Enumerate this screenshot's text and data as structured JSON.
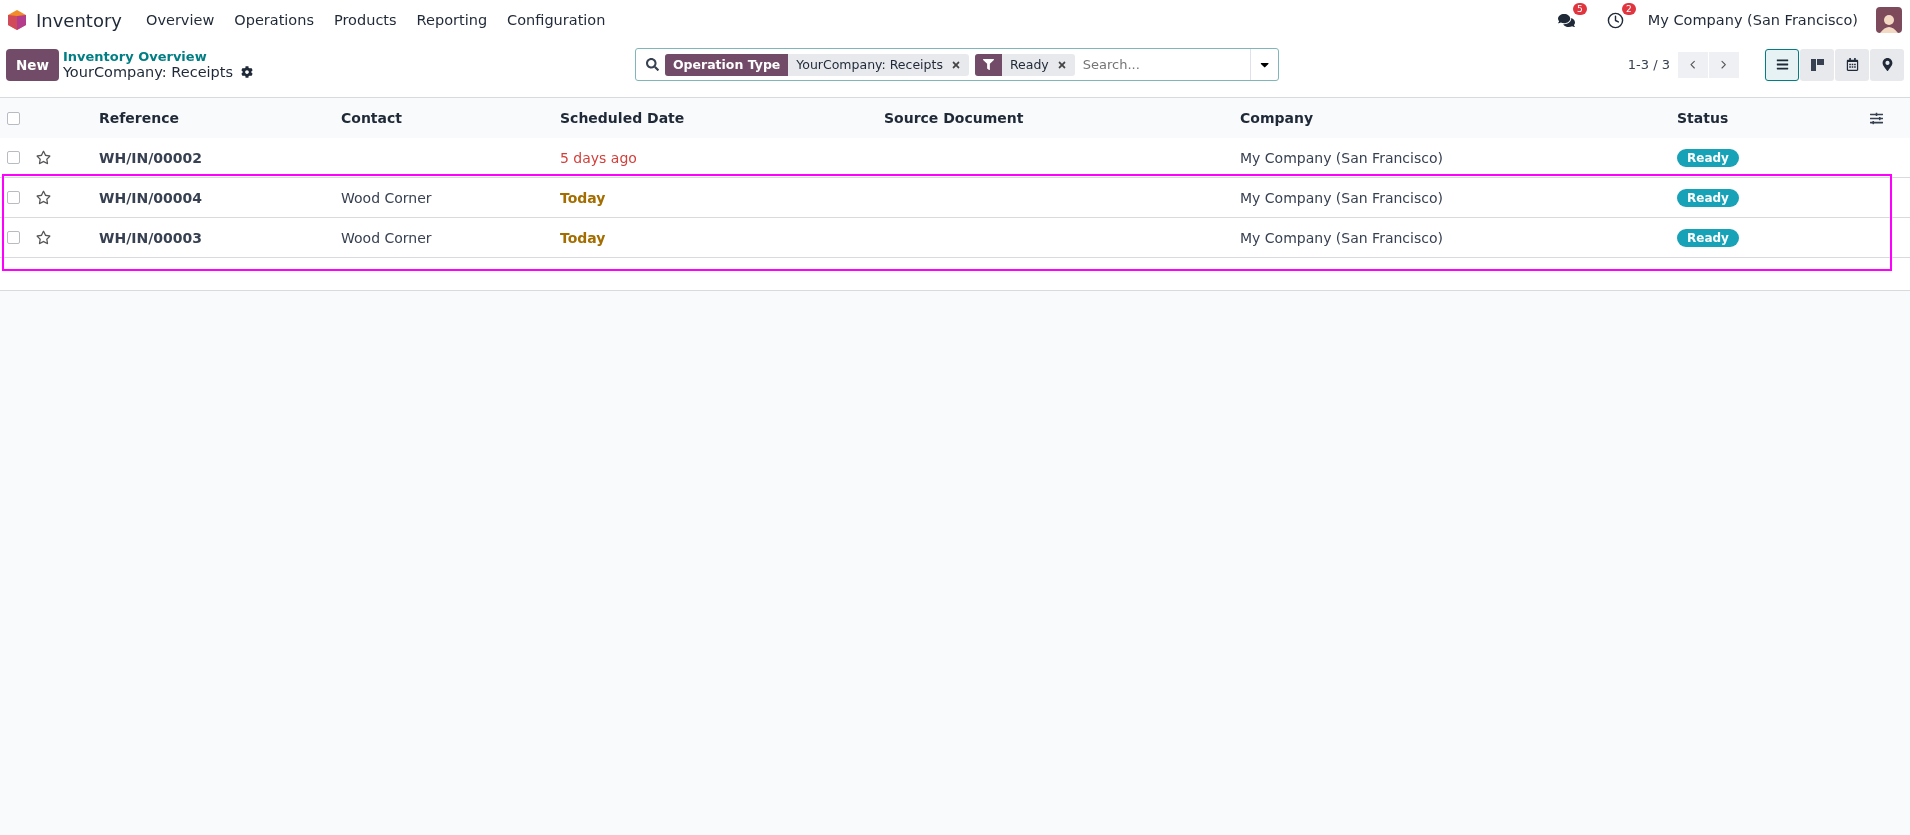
{
  "navbar": {
    "app_name": "Inventory",
    "menu": [
      "Overview",
      "Operations",
      "Products",
      "Reporting",
      "Configuration"
    ],
    "messages_count": "5",
    "activities_count": "2",
    "company": "My Company (San Francisco)"
  },
  "control_panel": {
    "new_button": "New",
    "breadcrumb_parent": "Inventory Overview",
    "breadcrumb_current": "YourCompany: Receipts",
    "facets": [
      {
        "kind": "field",
        "label": "Operation Type",
        "value": "YourCompany: Receipts"
      },
      {
        "kind": "filter",
        "value": "Ready"
      }
    ],
    "search_placeholder": "Search...",
    "pager": "1-3 / 3",
    "views": [
      {
        "kind": "list",
        "selected": true
      },
      {
        "kind": "kanban",
        "selected": false
      },
      {
        "kind": "calendar",
        "selected": false
      },
      {
        "kind": "map",
        "selected": false
      }
    ]
  },
  "table": {
    "select_all_checked": false,
    "columns": [
      "Reference",
      "Contact",
      "Scheduled Date",
      "Source Document",
      "Company",
      "Status"
    ],
    "rows": [
      {
        "checked": false,
        "favorite": false,
        "highlighted": false,
        "reference": "WH/IN/00002",
        "contact": "",
        "scheduled_date": "5 days ago",
        "overdue": true,
        "source_document": "",
        "company": "My Company (San Francisco)",
        "status": "Ready"
      },
      {
        "checked": false,
        "favorite": false,
        "highlighted": true,
        "reference": "WH/IN/00004",
        "contact": "Wood Corner",
        "scheduled_date": "Today",
        "overdue": false,
        "source_document": "",
        "company": "My Company (San Francisco)",
        "status": "Ready"
      },
      {
        "checked": false,
        "favorite": false,
        "highlighted": true,
        "reference": "WH/IN/00003",
        "contact": "Wood Corner",
        "scheduled_date": "Today",
        "overdue": false,
        "source_document": "",
        "company": "My Company (San Francisco)",
        "status": "Ready"
      }
    ]
  }
}
